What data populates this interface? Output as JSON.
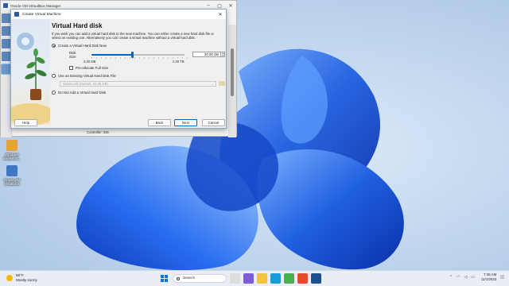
{
  "manager": {
    "title": "Oracle VM VirtualBox Manager",
    "detail_line": "Controller: IDE"
  },
  "desktop_icons": [
    {
      "label": "Windows Weekend..."
    },
    {
      "label": "Oracle VM VirtualBox"
    }
  ],
  "dialog": {
    "title": "Create Virtual Machine",
    "heading": "Virtual Hard disk",
    "description": "If you wish you can add a virtual hard disk to the new machine. You can either create a new hard disk file or select an existing one. Alternatively you can create a virtual machine without a virtual hard disk.",
    "option_create": "Create a Virtual Hard Disk Now",
    "disk_size_label": "Disk Size:",
    "disk_size_value": "20.00 GB",
    "disk_size_fraction": 0.44,
    "min_label": "4.00 MB",
    "max_label": "2.00 TB",
    "preallocate_label": "Pre-allocate Full Size",
    "option_existing": "Use an Existing Virtual Hard Disk File",
    "existing_file_value": "ubuntu.vdi (Normal, 81.35 GB)",
    "option_none": "Do Not Add a Virtual Hard Disk",
    "help_label": "Help",
    "back_label": "Back",
    "next_label": "Next",
    "cancel_label": "Cancel"
  },
  "taskbar": {
    "temperature": "58°F",
    "weather": "Mostly sunny",
    "search_placeholder": "Search",
    "time": "7:35 AM",
    "date": "11/1/2023"
  }
}
